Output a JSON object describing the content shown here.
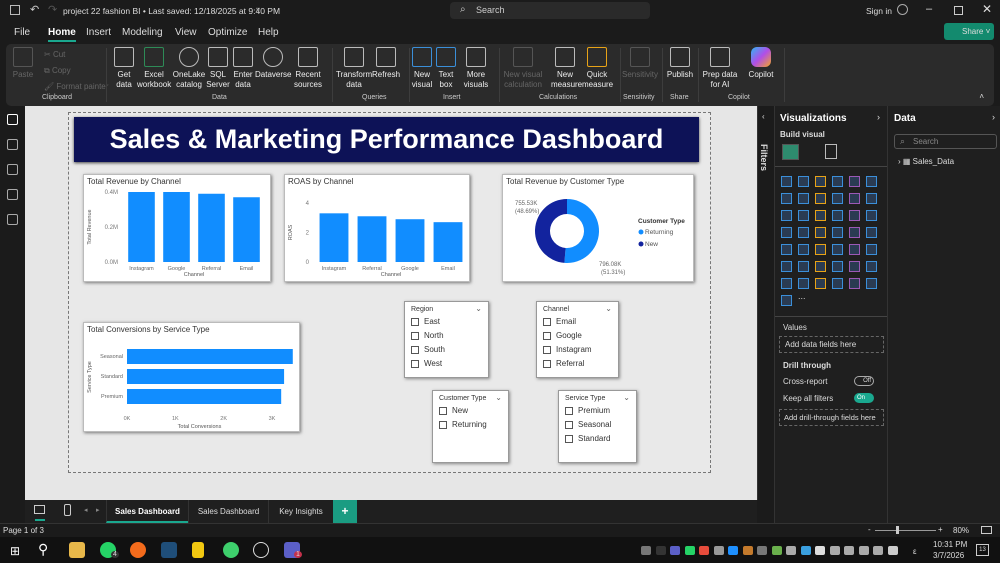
{
  "titlebar": {
    "doc_title": "project 22 fashion BI • Last saved: 12/18/2025 at 9:40 PM",
    "search": "Search",
    "sign_in": "Sign in"
  },
  "menu": {
    "items": [
      "File",
      "Home",
      "Insert",
      "Modeling",
      "View",
      "Optimize",
      "Help"
    ],
    "active": "Home",
    "share": "Share"
  },
  "ribbon": {
    "clipboard": {
      "paste": "Paste",
      "cut": "Cut",
      "copy": "Copy",
      "format_painter": "Format painter",
      "group": "Clipboard"
    },
    "data": {
      "get_data": "Get data",
      "excel": "Excel workbook",
      "onelake": "OneLake catalog",
      "sql": "SQL Server",
      "enter": "Enter data",
      "dataverse": "Dataverse",
      "recent": "Recent sources",
      "group": "Data"
    },
    "queries": {
      "transform": "Transform data",
      "refresh": "Refresh",
      "group": "Queries"
    },
    "insert": {
      "new_visual": "New visual",
      "text_box": "Text box",
      "more_visuals": "More visuals",
      "group": "Insert"
    },
    "calculations": {
      "new_visual_calc": "New visual calculation",
      "new_measure": "New measure",
      "quick_measure": "Quick measure",
      "group": "Calculations"
    },
    "sensitivity": {
      "label": "Sensitivity",
      "group": "Sensitivity"
    },
    "share": {
      "publish": "Publish",
      "group": "Share"
    },
    "copilot": {
      "prep": "Prep data for AI",
      "copilot": "Copilot",
      "group": "Copilot"
    }
  },
  "dashboard": {
    "title": "Sales & Marketing Performance Dashboard"
  },
  "chart_data": [
    {
      "type": "bar",
      "title": "Total Revenue by Channel",
      "categories": [
        "Instagram",
        "Google",
        "Referral",
        "Email"
      ],
      "values": [
        0.4,
        0.4,
        0.39,
        0.37
      ],
      "xlabel": "Channel",
      "ylabel": "Total Revenue",
      "ylim": [
        0,
        0.4
      ],
      "yticks": [
        "0.0M",
        "0.2M",
        "0.4M"
      ],
      "color": "#118DFF"
    },
    {
      "type": "bar",
      "title": "ROAS by Channel",
      "categories": [
        "Instagram",
        "Referral",
        "Google",
        "Email"
      ],
      "values": [
        3.3,
        3.1,
        2.9,
        2.7
      ],
      "xlabel": "Channel",
      "ylabel": "ROAS",
      "ylim": [
        0,
        4
      ],
      "yticks": [
        "0",
        "2",
        "4"
      ],
      "color": "#118DFF"
    },
    {
      "type": "pie",
      "title": "Total Revenue by Customer Type",
      "legend_title": "Customer Type",
      "slices": [
        {
          "name": "Returning",
          "value": 796.08,
          "label": "796.08K",
          "pct": "(51.31%)",
          "color": "#118DFF"
        },
        {
          "name": "New",
          "value": 755.53,
          "label": "755.53K",
          "pct": "(48.69%)",
          "color": "#12239E"
        }
      ]
    },
    {
      "type": "bar",
      "orientation": "horizontal",
      "title": "Total Conversions by Service Type",
      "categories": [
        "Seasonal",
        "Standard",
        "Premium"
      ],
      "values": [
        3430,
        3250,
        3190
      ],
      "xlabel": "Total Conversions",
      "ylabel": "Service Type",
      "xlim": [
        0,
        3000
      ],
      "xticks": [
        "0K",
        "1K",
        "2K",
        "3K"
      ],
      "color": "#118DFF"
    }
  ],
  "slicers": {
    "region": {
      "title": "Region",
      "items": [
        "East",
        "North",
        "South",
        "West"
      ]
    },
    "channel": {
      "title": "Channel",
      "items": [
        "Email",
        "Google",
        "Instagram",
        "Referral"
      ]
    },
    "customer_type": {
      "title": "Customer Type",
      "items": [
        "New",
        "Returning"
      ]
    },
    "service_type": {
      "title": "Service Type",
      "items": [
        "Premium",
        "Seasonal",
        "Standard"
      ]
    }
  },
  "filters": {
    "label": "Filters"
  },
  "viz": {
    "title": "Visualizations",
    "build": "Build visual",
    "values": "Values",
    "add_fields": "Add data fields here",
    "drill": "Drill through",
    "cross": "Cross-report",
    "cross_state": "Off",
    "keep": "Keep all filters",
    "keep_state": "On",
    "add_drill": "Add drill-through fields here",
    "more": "..."
  },
  "data_pane": {
    "title": "Data",
    "search_placeholder": "Search",
    "tables": [
      "Sales_Data"
    ]
  },
  "page_tabs": [
    "Sales Dashboard",
    "Sales Dashboard",
    "Key Insights"
  ],
  "status": {
    "page": "Page 1 of 3",
    "zoom": "80%"
  },
  "taskbar": {
    "time": "10:31 PM",
    "date": "3/7/2026",
    "whatsapp_badge": "4",
    "teams_badge": "1",
    "notif": "13",
    "lang": "ε"
  }
}
